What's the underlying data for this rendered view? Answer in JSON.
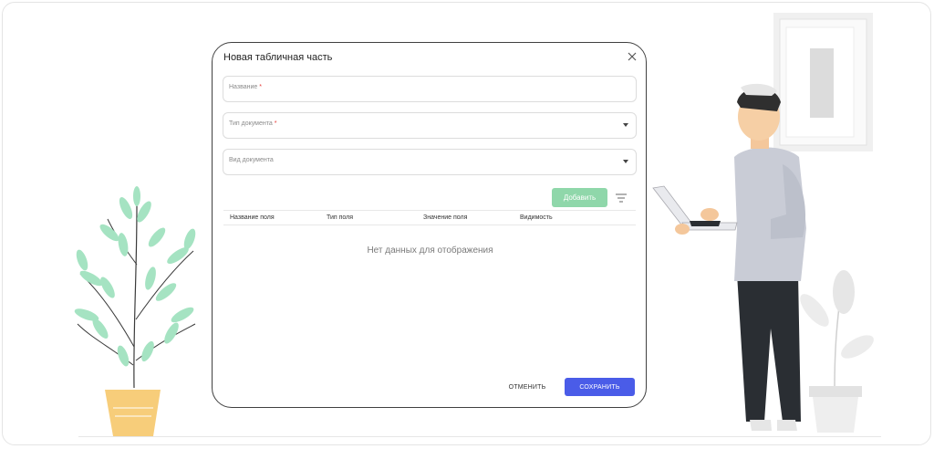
{
  "dialog": {
    "title": "Новая табличная часть",
    "close_icon": "close-icon",
    "fields": {
      "name": {
        "label": "Название",
        "required": "*"
      },
      "doc_type": {
        "label": "Тип документа",
        "required": "*"
      },
      "doc_kind": {
        "label": "Вид документа"
      }
    },
    "add_button": "Добавить",
    "filter_icon": "filter-icon",
    "table": {
      "columns": [
        "Название поля",
        "Тип поля",
        "Значение поля",
        "Видимость"
      ],
      "empty_text": "Нет данных для отображения"
    },
    "cancel_button": "ОТМЕНИТЬ",
    "save_button": "СОХРАНИТЬ"
  },
  "colors": {
    "accent": "#4a5ce8",
    "add_button": "#8fd7aa",
    "required": "#e53935",
    "plant_leaf": "#a5e3c2",
    "pot": "#f7cd7a"
  }
}
